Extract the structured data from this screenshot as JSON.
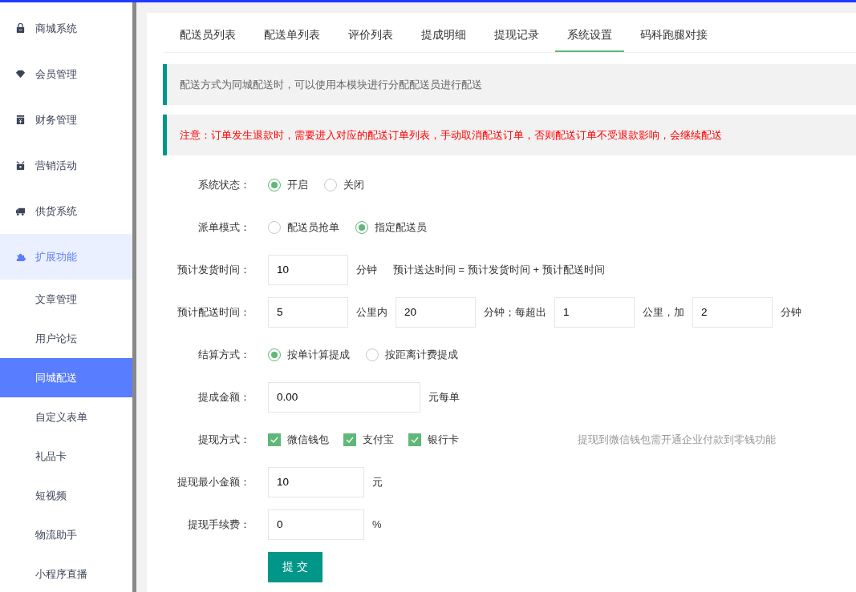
{
  "sidebar": {
    "items": [
      {
        "label": "商城系统",
        "expanded": false
      },
      {
        "label": "会员管理",
        "expanded": false
      },
      {
        "label": "财务管理",
        "expanded": false
      },
      {
        "label": "营销活动",
        "expanded": false
      },
      {
        "label": "供货系统",
        "expanded": false
      },
      {
        "label": "扩展功能",
        "expanded": true,
        "children": [
          {
            "label": "文章管理",
            "selected": false
          },
          {
            "label": "用户论坛",
            "selected": false
          },
          {
            "label": "同城配送",
            "selected": true
          },
          {
            "label": "自定义表单",
            "selected": false
          },
          {
            "label": "礼品卡",
            "selected": false
          },
          {
            "label": "短视频",
            "selected": false
          },
          {
            "label": "物流助手",
            "selected": false
          },
          {
            "label": "小程序直播",
            "selected": false
          }
        ]
      }
    ]
  },
  "tabs": [
    {
      "label": "配送员列表",
      "selected": false
    },
    {
      "label": "配送单列表",
      "selected": false
    },
    {
      "label": "评价列表",
      "selected": false
    },
    {
      "label": "提成明细",
      "selected": false
    },
    {
      "label": "提现记录",
      "selected": false
    },
    {
      "label": "系统设置",
      "selected": true
    },
    {
      "label": "码科跑腿对接",
      "selected": false
    }
  ],
  "notices": [
    {
      "kind": "info",
      "text": "配送方式为同城配送时，可以使用本模块进行分配配送员进行配送"
    },
    {
      "kind": "warning",
      "text": "注意：订单发生退款时，需要进入对应的配送订单列表，手动取消配送订单，否则配送订单不受退款影响，会继续配送"
    }
  ],
  "form": {
    "rows": [
      {
        "kind": "radio",
        "label": "系统状态：",
        "options": [
          {
            "label": "开启",
            "selected": true
          },
          {
            "label": "关闭",
            "selected": false
          }
        ]
      },
      {
        "kind": "radio",
        "label": "派单模式：",
        "options": [
          {
            "label": "配送员抢单",
            "selected": false
          },
          {
            "label": "指定配送员",
            "selected": true
          }
        ]
      },
      {
        "kind": "inputs",
        "label": "预计发货时间：",
        "parts": [
          {
            "kind": "input",
            "value": "10"
          },
          {
            "kind": "text",
            "text": "分钟"
          },
          {
            "kind": "text",
            "text": "预计送达时间 = 预计发货时间 + 预计配送时间"
          }
        ]
      },
      {
        "kind": "inputs",
        "label": "预计配送时间：",
        "parts": [
          {
            "kind": "input",
            "value": "5"
          },
          {
            "kind": "text",
            "text": "公里内"
          },
          {
            "kind": "input",
            "value": "20"
          },
          {
            "kind": "text",
            "text": "分钟；每超出"
          },
          {
            "kind": "input",
            "value": "1"
          },
          {
            "kind": "text",
            "text": "公里，加"
          },
          {
            "kind": "input",
            "value": "2"
          },
          {
            "kind": "text",
            "text": "分钟"
          }
        ]
      },
      {
        "kind": "radio",
        "label": "结算方式：",
        "options": [
          {
            "label": "按单计算提成",
            "selected": true
          },
          {
            "label": "按距离计费提成",
            "selected": false
          }
        ]
      },
      {
        "kind": "inputs",
        "label": "提成金额：",
        "parts": [
          {
            "kind": "input",
            "value": "0.00"
          },
          {
            "kind": "text",
            "text": "元每单"
          }
        ]
      },
      {
        "kind": "checkbox",
        "label": "提现方式：",
        "options": [
          {
            "label": "微信钱包",
            "checked": true
          },
          {
            "label": "支付宝",
            "checked": true
          },
          {
            "label": "银行卡",
            "checked": true
          }
        ],
        "hint": "提现到微信钱包需开通企业付款到零钱功能"
      },
      {
        "kind": "inputs",
        "label": "提现最小金额：",
        "parts": [
          {
            "kind": "input",
            "value": "10"
          },
          {
            "kind": "text",
            "text": "元"
          }
        ]
      },
      {
        "kind": "inputs",
        "label": "提现手续费：",
        "parts": [
          {
            "kind": "input",
            "value": "0"
          },
          {
            "kind": "text",
            "text": "%"
          }
        ]
      }
    ],
    "submit": "提 交"
  }
}
